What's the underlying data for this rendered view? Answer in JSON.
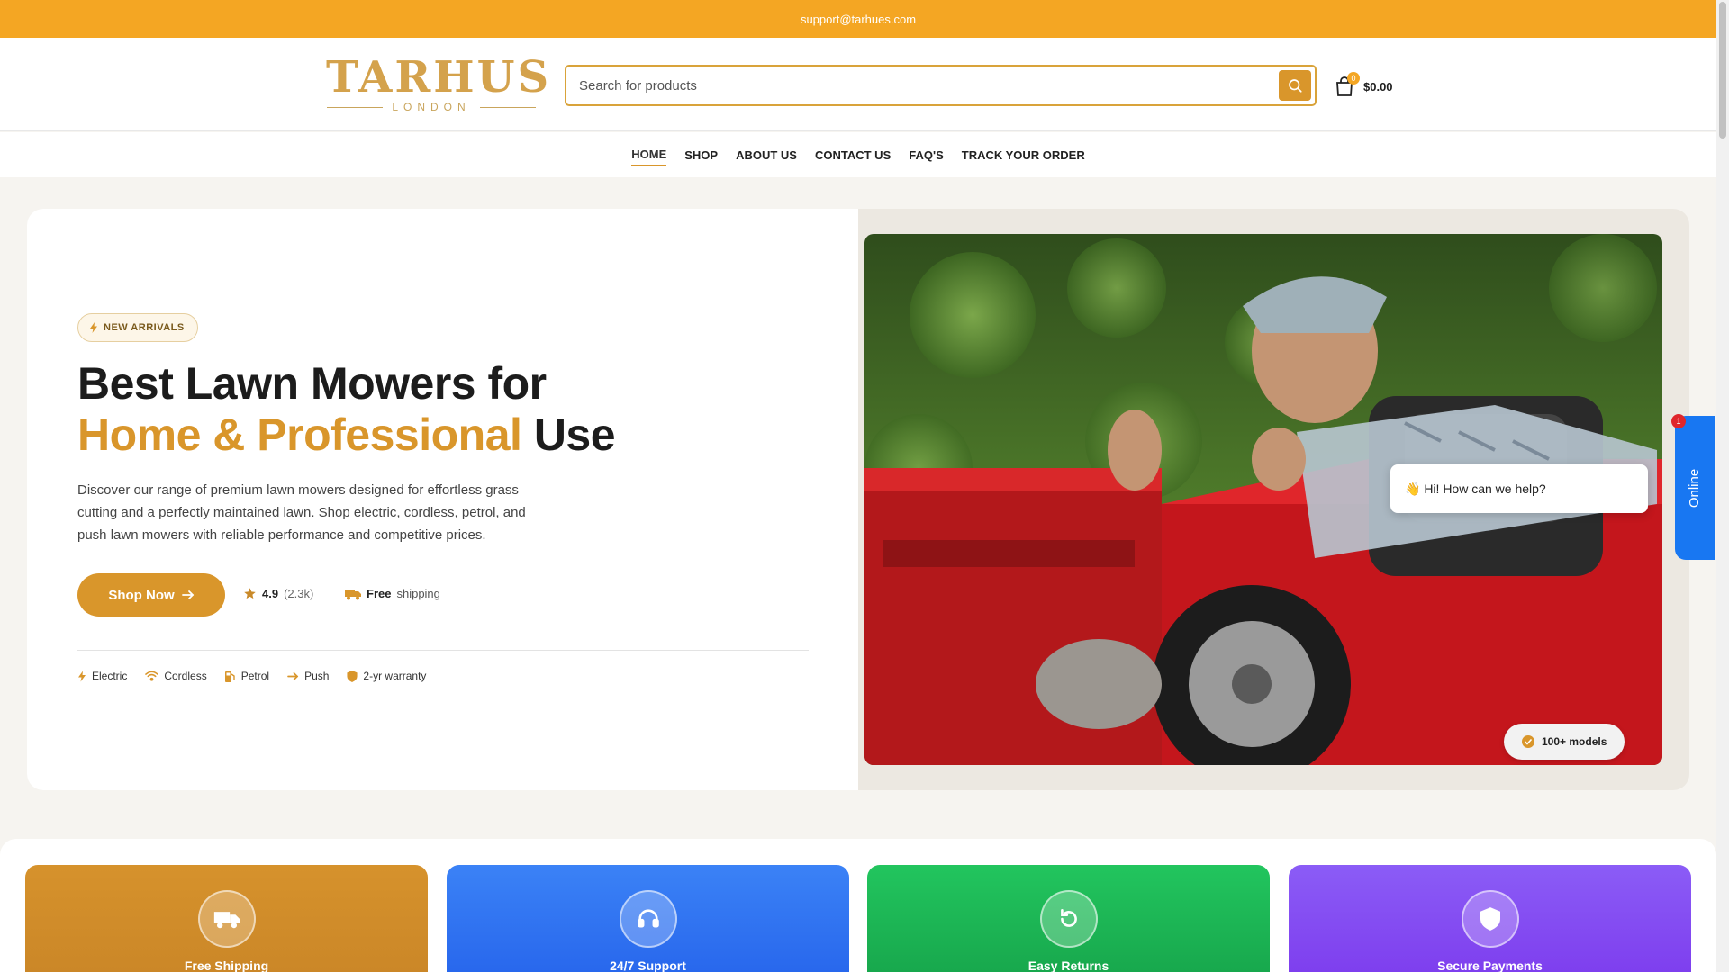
{
  "topbar": {
    "email": "support@tarhues.com"
  },
  "logo": {
    "main": "TARHUS",
    "sub": "LONDON"
  },
  "search": {
    "placeholder": "Search for products"
  },
  "cart": {
    "count": "0",
    "total": "$0.00"
  },
  "nav": {
    "items": [
      "HOME",
      "SHOP",
      "ABOUT US",
      "CONTACT US",
      "FAQ'S",
      "TRACK YOUR ORDER"
    ],
    "active": "HOME"
  },
  "hero": {
    "badge": "NEW ARRIVALS",
    "title_line1": "Best Lawn Mowers for",
    "title_accent": "Home & Professional",
    "title_end": "Use",
    "description": "Discover our range of premium lawn mowers designed for effortless grass cutting and a perfectly maintained lawn. Shop electric, cordless, petrol, and push lawn mowers with reliable performance and competitive prices.",
    "cta": "Shop Now",
    "rating": "4.9",
    "rating_count": "(2.3k)",
    "shipping_bold": "Free",
    "shipping_rest": "shipping",
    "features": [
      "Electric",
      "Cordless",
      "Petrol",
      "Push",
      "2-yr warranty"
    ],
    "models_pill": "100+ models"
  },
  "chat": {
    "bubble": "👋 Hi! How can we help?",
    "tab_label": "Online",
    "badge": "1"
  },
  "cards": [
    {
      "label": "Free Shipping",
      "color_from": "#d6922c",
      "color_to": "#c98527",
      "icon": "truck-icon"
    },
    {
      "label": "24/7 Support",
      "color_from": "#3b82f6",
      "color_to": "#2563eb",
      "icon": "headset-icon"
    },
    {
      "label": "Easy Returns",
      "color_from": "#22c55e",
      "color_to": "#16a34a",
      "icon": "refresh-icon"
    },
    {
      "label": "Secure Payments",
      "color_from": "#8b5cf6",
      "color_to": "#7c3aed",
      "icon": "shield-icon"
    }
  ],
  "colors": {
    "accent": "#d9962b",
    "topbar": "#f4a623",
    "chat_blue": "#1877f2"
  }
}
